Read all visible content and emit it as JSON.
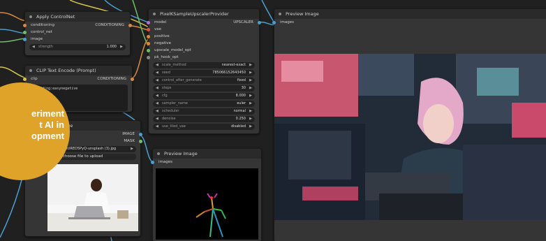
{
  "badge": {
    "line1": "eriment",
    "line2": "t AI in",
    "line3": "opment"
  },
  "apply_controlnet": {
    "title": "Apply ControlNet",
    "inputs": [
      "conditioning",
      "control_net",
      "image"
    ],
    "output": "CONDITIONING",
    "strength": {
      "name": "strength",
      "value": "1.000"
    }
  },
  "clip_text": {
    "title": "CLIP Text Encode (Prompt)",
    "input": "clip",
    "output": "CONDITIONING",
    "text": "embedding:easynegative"
  },
  "load_image": {
    "title": "Image",
    "outputs": [
      "IMAGE",
      "MASK"
    ],
    "file": "-lsgun-7zHURED5PyQ-unsplash (3).jpg",
    "upload_label": "choose file to upload"
  },
  "pixel_upscaler": {
    "title": "PixelKSampleUpscalerProvider",
    "inputs": [
      "model",
      "vae",
      "positive",
      "negative",
      "upscale_model_opt",
      "pk_hook_opt"
    ],
    "output": "UPSCALER",
    "widgets": [
      {
        "name": "scale_method",
        "value": "nearest-exact"
      },
      {
        "name": "seed",
        "value": "785066152643450"
      },
      {
        "name": "control_after_generate",
        "value": "fixed"
      },
      {
        "name": "steps",
        "value": "30"
      },
      {
        "name": "cfg",
        "value": "8.000"
      },
      {
        "name": "sampler_name",
        "value": "euler"
      },
      {
        "name": "scheduler",
        "value": "normal"
      },
      {
        "name": "denoise",
        "value": "0.250"
      },
      {
        "name": "use_tiled_vae",
        "value": "disabled"
      }
    ]
  },
  "preview_small": {
    "title": "Preview Image",
    "input": "images"
  },
  "preview_large": {
    "title": "Preview Image",
    "input": "images"
  },
  "colors": {
    "accent_badge": "#e0a32a",
    "wire_blue": "#4a9fd0",
    "wire_yellow": "#d9c34a",
    "wire_orange": "#d98a3a",
    "wire_green": "#6fbf6a",
    "slot_purple": "#b36fd0"
  }
}
